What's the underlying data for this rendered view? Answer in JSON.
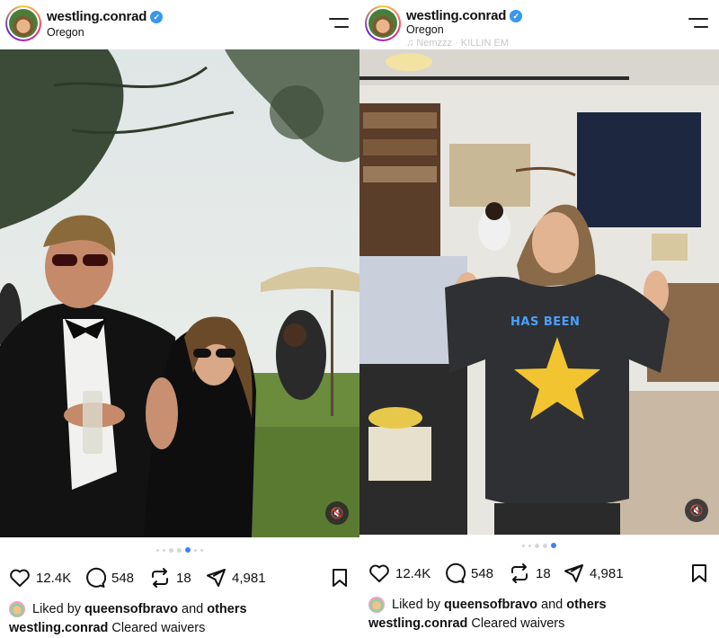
{
  "posts": [
    {
      "username": "westling.conrad",
      "location": "Oregon",
      "music": "",
      "likes": "12.4K",
      "comments": "548",
      "reposts": "18",
      "shares": "4,981",
      "liked_prefix": "Liked by",
      "liked_user": "queensofbravo",
      "liked_and": "and",
      "liked_others": "others",
      "caption_user": "westling.conrad",
      "caption_text": "Cleared waivers",
      "carousel": {
        "count": 7,
        "active_index": 4
      },
      "photo_description_icons": [
        "mute-icon"
      ]
    },
    {
      "username": "westling.conrad",
      "location": "Oregon",
      "music": "♫ Nemzzz · KILLIN EM",
      "shirt_text": "HAS BEEN",
      "likes": "12.4K",
      "comments": "548",
      "reposts": "18",
      "shares": "4,981",
      "liked_prefix": "Liked by",
      "liked_user": "queensofbravo",
      "liked_and": "and",
      "liked_others": "others",
      "caption_user": "westling.conrad",
      "caption_text": "Cleared waivers",
      "carousel": {
        "count": 5,
        "active_index": 4
      }
    }
  ],
  "colors": {
    "accent": "#3897f0",
    "dot_active": "#3b82f6"
  }
}
